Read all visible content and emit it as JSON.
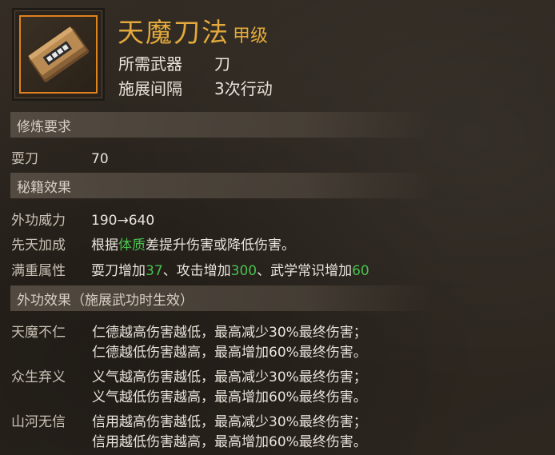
{
  "skill": {
    "name": "天魔刀法",
    "grade": "甲级",
    "icon": "book-icon",
    "info": [
      {
        "label": "所需武器",
        "value": "刀"
      },
      {
        "label": "施展间隔",
        "value": "3次行动"
      }
    ]
  },
  "sections": {
    "requirements": {
      "title": "修炼要求",
      "rows": [
        {
          "key": "耍刀",
          "value": "70"
        }
      ]
    },
    "secret": {
      "title": "秘籍效果",
      "power": {
        "key": "外功威力",
        "value": "190→640"
      },
      "innate": {
        "key": "先天加成",
        "pre": "根据",
        "attr": "体质",
        "post": "差提升伤害或降低伤害。"
      },
      "full": {
        "key": "满重属性",
        "p1": "耍刀增加",
        "v1": "37",
        "p2": "、攻击增加",
        "v2": "300",
        "p3": "、武学常识增加",
        "v3": "60"
      }
    },
    "external": {
      "title": "外功效果（施展武功时生效）",
      "effects": [
        {
          "key": "天魔不仁",
          "lines": [
            "仁德越高伤害越低，最高减少30%最终伤害；",
            "仁德越低伤害越高，最高增加60%最终伤害。"
          ]
        },
        {
          "key": "众生弃义",
          "lines": [
            "义气越高伤害越低，最高减少30%最终伤害；",
            "义气越低伤害越高，最高增加60%最终伤害。"
          ]
        },
        {
          "key": "山河无信",
          "lines": [
            "信用越高伤害越低，最高减少30%最终伤害；",
            "信用越低伤害越高，最高增加60%最终伤害。"
          ]
        }
      ]
    }
  },
  "colors": {
    "title": "#e3a93c",
    "highlight": "#49c04f",
    "icon_border": "#e0801e"
  }
}
